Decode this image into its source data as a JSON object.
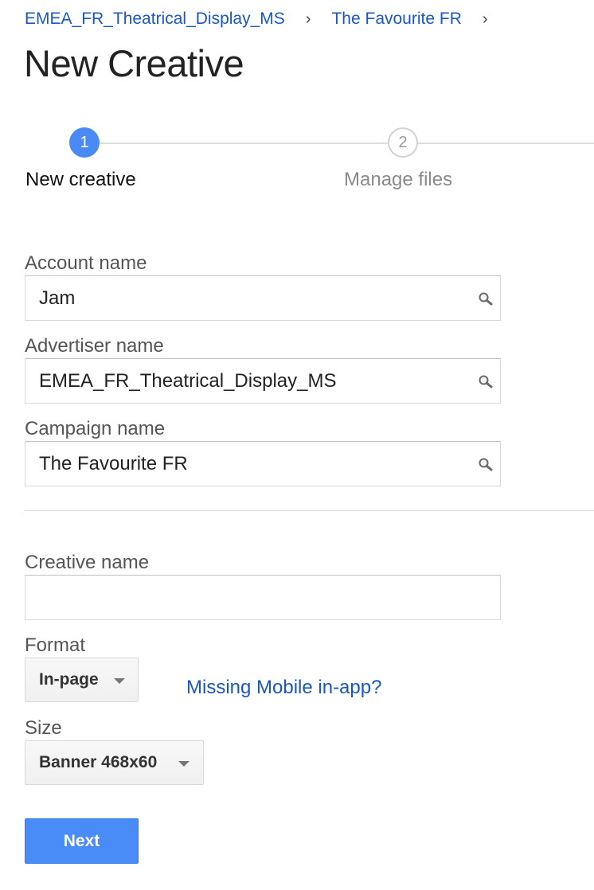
{
  "breadcrumb": {
    "items": [
      {
        "label": "EMEA_FR_Theatrical_Display_MS"
      },
      {
        "label": "The Favourite FR"
      }
    ],
    "separator": "›"
  },
  "page_title": "New Creative",
  "stepper": {
    "steps": [
      {
        "number": "1",
        "label": "New creative",
        "state": "active"
      },
      {
        "number": "2",
        "label": "Manage files",
        "state": "inactive"
      }
    ]
  },
  "form": {
    "account": {
      "label": "Account name",
      "value": "Jam",
      "icon": "search-icon"
    },
    "advertiser": {
      "label": "Advertiser name",
      "value": "EMEA_FR_Theatrical_Display_MS",
      "icon": "search-icon"
    },
    "campaign": {
      "label": "Campaign name",
      "value": "The Favourite FR",
      "icon": "search-icon"
    },
    "creative": {
      "label": "Creative name",
      "value": ""
    },
    "format": {
      "label": "Format",
      "selected": "In-page"
    },
    "missing_link": "Missing Mobile in-app?",
    "size": {
      "label": "Size",
      "selected": "Banner 468x60"
    },
    "next_label": "Next"
  },
  "colors": {
    "link": "#1a57c4",
    "accent": "#4a8af4",
    "button": "#4a8cf7"
  }
}
